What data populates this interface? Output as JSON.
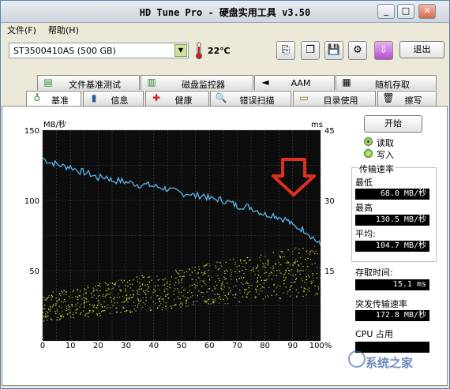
{
  "window": {
    "title": "HD Tune Pro - 硬盘实用工具 v3.50",
    "min_label": "_",
    "max_label": "□",
    "close_label": "✕"
  },
  "menu": {
    "file": "文件(F)",
    "help": "帮助(H)"
  },
  "toolbar": {
    "drive": "ST3500410AS (500 GB)",
    "temperature": "22℃",
    "exit": "退出"
  },
  "tabs_top": [
    {
      "label": "文件基准测试",
      "icon": "file-benchmark-icon"
    },
    {
      "label": "磁盘监控器",
      "icon": "disk-monitor-icon"
    },
    {
      "label": "AAM",
      "icon": "speaker-icon"
    },
    {
      "label": "随机存取",
      "icon": "random-access-icon"
    }
  ],
  "tabs_bottom": [
    {
      "label": "基准",
      "icon": "benchmark-icon"
    },
    {
      "label": "信息",
      "icon": "info-icon"
    },
    {
      "label": "健康",
      "icon": "health-icon"
    },
    {
      "label": "错误扫描",
      "icon": "error-scan-icon"
    },
    {
      "label": "目录使用",
      "icon": "folder-usage-icon"
    },
    {
      "label": "擦写",
      "icon": "erase-icon"
    }
  ],
  "controls": {
    "start": "开始",
    "read": "读取",
    "write": "写入",
    "mode_selected": "读取"
  },
  "stats": {
    "transfer_rate_title": "传输速率",
    "min_label": "最低",
    "min_value": "68.0 MB/秒",
    "max_label": "最高",
    "max_value": "130.5 MB/秒",
    "avg_label": "平均:",
    "avg_value": "104.7 MB/秒",
    "access_label": "存取时间:",
    "access_value": "15.1 ms",
    "burst_label": "突发传输速率",
    "burst_value": "172.8 MB/秒",
    "cpu_label": "CPU 占用",
    "cpu_value": ""
  },
  "watermark": "系统之家",
  "chart_data": {
    "type": "line",
    "ylabel_left": "MB/秒",
    "ylabel_right": "ms",
    "xlim": [
      0,
      100
    ],
    "ylim_left": [
      0,
      150
    ],
    "ylim_right": [
      0,
      45
    ],
    "x_ticks": [
      "0",
      "10",
      "20",
      "30",
      "40",
      "50",
      "60",
      "70",
      "80",
      "90",
      "100%"
    ],
    "y_ticks_left": [
      "150",
      "100",
      "50"
    ],
    "y_ticks_right": [
      "45",
      "30",
      "15"
    ],
    "grid": true,
    "series": [
      {
        "color": "#5fb6e8",
        "x": [
          0,
          3,
          5,
          8,
          10,
          13,
          15,
          18,
          20,
          23,
          25,
          28,
          30,
          33,
          35,
          38,
          40,
          43,
          45,
          48,
          50,
          53,
          55,
          58,
          60,
          63,
          65,
          68,
          70,
          73,
          75,
          78,
          80,
          83,
          85,
          88,
          90,
          93,
          95,
          98,
          100
        ],
        "y": [
          130,
          127,
          126,
          124,
          124,
          121,
          120,
          118,
          116,
          117,
          114,
          114,
          113,
          112,
          111,
          111,
          110,
          109,
          108,
          106,
          105,
          105,
          103,
          104,
          101,
          101,
          100,
          98,
          96,
          96,
          95,
          92,
          90,
          90,
          88,
          86,
          82,
          80,
          78,
          72,
          68
        ]
      },
      {
        "type": "scatter",
        "axis": "right",
        "color": "#e6e64a",
        "points_note_range_ms": [
          5,
          20
        ]
      }
    ],
    "annotation": {
      "type": "arrow",
      "color": "#e03020"
    }
  }
}
